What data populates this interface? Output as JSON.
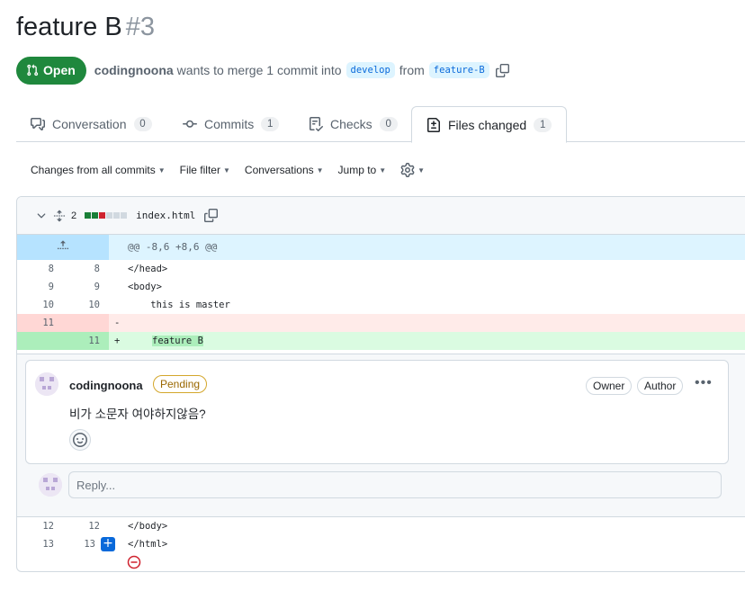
{
  "pr": {
    "title": "feature B",
    "number": "#3",
    "state": "Open",
    "author": "codingnoona",
    "merge_text": "wants to merge 1 commit into",
    "base_branch": "develop",
    "from_text": "from",
    "head_branch": "feature-B"
  },
  "tabs": [
    {
      "label": "Conversation",
      "count": "0"
    },
    {
      "label": "Commits",
      "count": "1"
    },
    {
      "label": "Checks",
      "count": "0"
    },
    {
      "label": "Files changed",
      "count": "1"
    }
  ],
  "toolbar": {
    "changes": "Changes from all commits",
    "file_filter": "File filter",
    "conversations": "Conversations",
    "jump_to": "Jump to"
  },
  "file": {
    "changes_count": "2",
    "name": "index.html",
    "hunk_header": "@@ -8,6 +8,6 @@",
    "diffstat_colors": [
      "#1a7f37",
      "#1a7f37",
      "#cf222e",
      "#d1d9e0",
      "#d1d9e0",
      "#d1d9e0"
    ]
  },
  "lines": [
    {
      "old": "8",
      "new": "8",
      "sign": "",
      "code": "</head>"
    },
    {
      "old": "9",
      "new": "9",
      "sign": "",
      "code": "<body>"
    },
    {
      "old": "10",
      "new": "10",
      "sign": "",
      "code": "    this is master"
    },
    {
      "old": "11",
      "new": "",
      "sign": "-",
      "code": ""
    },
    {
      "old": "",
      "new": "11",
      "sign": "+",
      "code": "feature B"
    }
  ],
  "comment": {
    "author": "codingnoona",
    "status": "Pending",
    "role_owner": "Owner",
    "role_author": "Author",
    "body": "비가 소문자 여야하지않음?",
    "reply_placeholder": "Reply..."
  },
  "lines_after": [
    {
      "old": "12",
      "new": "12",
      "code": "</body>"
    },
    {
      "old": "13",
      "new": "13",
      "code": "</html>"
    }
  ],
  "colors": {
    "open_green": "#1f883d",
    "accent_blue": "#0969da",
    "deletion_bg": "#ffebe9",
    "addition_bg": "#dafbe1",
    "pending_yellow": "#9a6700"
  }
}
